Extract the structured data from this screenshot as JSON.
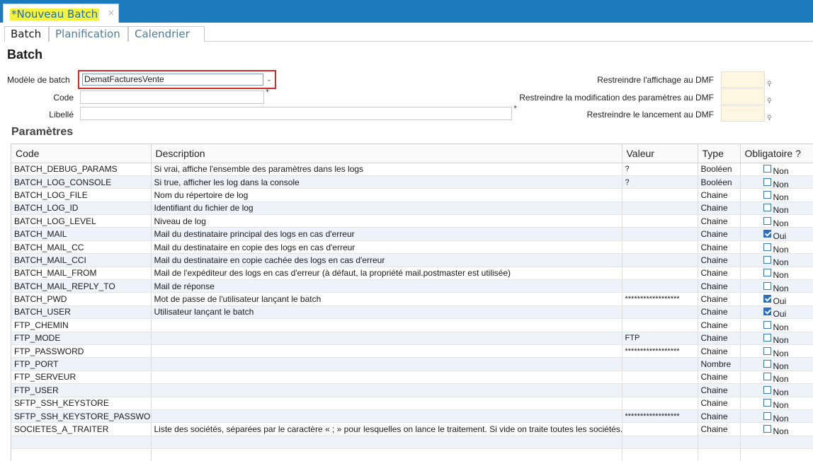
{
  "doc_tab": {
    "title": "*Nouveau Batch",
    "close": "×"
  },
  "subtabs": [
    "Batch",
    "Planification",
    "Calendrier"
  ],
  "page_title": "Batch",
  "form": {
    "model_label": "Modèle de batch",
    "model_value": "DematFacturesVente",
    "code_label": "Code",
    "code_value": "",
    "libelle_label": "Libellé",
    "libelle_value": "",
    "required_mark": "*",
    "dmf_display_label": "Restreindre l'affichage au DMF",
    "dmf_modify_label": "Restreindre la modification des paramètres au DMF",
    "dmf_launch_label": "Restreindre le lancement au DMF",
    "dmf_mark": "♀"
  },
  "section_title": "Paramètres",
  "table": {
    "headers": [
      "Code",
      "Description",
      "Valeur",
      "Type",
      "Obligatoire ?"
    ],
    "rows": [
      {
        "code": "BATCH_DEBUG_PARAMS",
        "desc": "Si vrai, affiche l'ensemble des paramètres dans les logs",
        "value": "?",
        "type": "Booléen",
        "required": "Non",
        "checked": false
      },
      {
        "code": "BATCH_LOG_CONSOLE",
        "desc": "Si true, afficher les log dans la console",
        "value": "?",
        "type": "Booléen",
        "required": "Non",
        "checked": false
      },
      {
        "code": "BATCH_LOG_FILE",
        "desc": "Nom du répertoire de log",
        "value": "",
        "type": "Chaine",
        "required": "Non",
        "checked": false
      },
      {
        "code": "BATCH_LOG_ID",
        "desc": "Identifiant du fichier de log",
        "value": "",
        "type": "Chaine",
        "required": "Non",
        "checked": false
      },
      {
        "code": "BATCH_LOG_LEVEL",
        "desc": "Niveau de log",
        "value": "",
        "type": "Chaine",
        "required": "Non",
        "checked": false
      },
      {
        "code": "BATCH_MAIL",
        "desc": "Mail du destinataire principal des logs en cas d'erreur",
        "value": "",
        "type": "Chaine",
        "required": "Oui",
        "checked": true
      },
      {
        "code": "BATCH_MAIL_CC",
        "desc": "Mail du destinataire en copie des logs en cas d'erreur",
        "value": "",
        "type": "Chaine",
        "required": "Non",
        "checked": false
      },
      {
        "code": "BATCH_MAIL_CCI",
        "desc": "Mail du destinataire en copie cachée des logs en cas d'erreur",
        "value": "",
        "type": "Chaine",
        "required": "Non",
        "checked": false
      },
      {
        "code": "BATCH_MAIL_FROM",
        "desc": "Mail de l'expéditeur des logs en cas d'erreur (à défaut, la propriété mail.postmaster est utilisée)",
        "value": "",
        "type": "Chaine",
        "required": "Non",
        "checked": false
      },
      {
        "code": "BATCH_MAIL_REPLY_TO",
        "desc": "Mail de réponse",
        "value": "",
        "type": "Chaine",
        "required": "Non",
        "checked": false
      },
      {
        "code": "BATCH_PWD",
        "desc": "Mot de passe de l'utilisateur lançant le batch",
        "value": "******************",
        "type": "Chaine",
        "required": "Oui",
        "checked": true
      },
      {
        "code": "BATCH_USER",
        "desc": "Utilisateur lançant le batch",
        "value": "",
        "type": "Chaine",
        "required": "Oui",
        "checked": true
      },
      {
        "code": "FTP_CHEMIN",
        "desc": "",
        "value": "",
        "type": "Chaine",
        "required": "Non",
        "checked": false
      },
      {
        "code": "FTP_MODE",
        "desc": "",
        "value": "FTP",
        "type": "Chaine",
        "required": "Non",
        "checked": false
      },
      {
        "code": "FTP_PASSWORD",
        "desc": "",
        "value": "******************",
        "type": "Chaine",
        "required": "Non",
        "checked": false
      },
      {
        "code": "FTP_PORT",
        "desc": "",
        "value": "",
        "type": "Nombre",
        "required": "Non",
        "checked": false
      },
      {
        "code": "FTP_SERVEUR",
        "desc": "",
        "value": "",
        "type": "Chaine",
        "required": "Non",
        "checked": false
      },
      {
        "code": "FTP_USER",
        "desc": "",
        "value": "",
        "type": "Chaine",
        "required": "Non",
        "checked": false
      },
      {
        "code": "SFTP_SSH_KEYSTORE",
        "desc": "",
        "value": "",
        "type": "Chaine",
        "required": "Non",
        "checked": false
      },
      {
        "code": "SFTP_SSH_KEYSTORE_PASSWORD",
        "desc": "",
        "value": "******************",
        "type": "Chaine",
        "required": "Non",
        "checked": false
      },
      {
        "code": "SOCIETES_A_TRAITER",
        "desc": "Liste des sociétés, séparées par le caractère « ; » pour lesquelles on lance le traitement. Si vide on traite toutes les sociétés.",
        "value": "",
        "type": "Chaine",
        "required": "Non",
        "checked": false
      }
    ]
  }
}
